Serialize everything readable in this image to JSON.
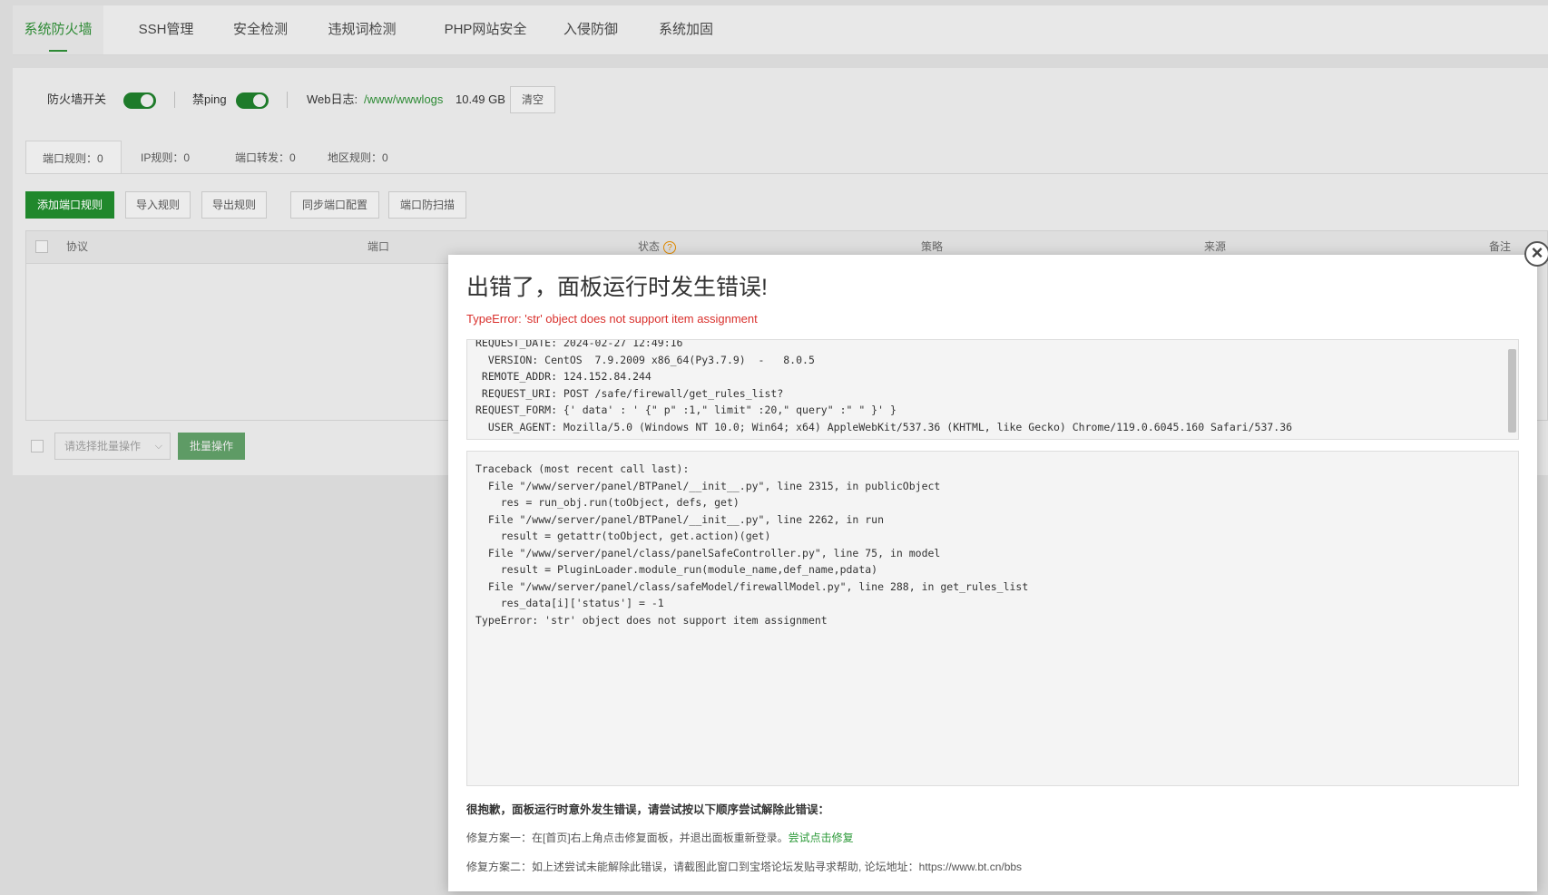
{
  "topnav": {
    "tabs": [
      {
        "label": "系统防火墙",
        "active": true
      },
      {
        "label": "SSH管理"
      },
      {
        "label": "安全检测"
      },
      {
        "label": "违规词检测"
      },
      {
        "label": "PHP网站安全"
      },
      {
        "label": "入侵防御"
      },
      {
        "label": "系统加固"
      }
    ]
  },
  "statusbar": {
    "firewall_label": "防火墙开关",
    "ping_label": "禁ping",
    "weblog_label": "Web日志:",
    "weblog_path": "/www/wwwlogs",
    "weblog_size": "10.49 GB",
    "clear_label": "清空"
  },
  "subtabs": [
    {
      "label": "端口规则：0",
      "active": true
    },
    {
      "label": "IP规则：0"
    },
    {
      "label": "端口转发：0"
    },
    {
      "label": "地区规则：0"
    }
  ],
  "actions": {
    "add": "添加端口规则",
    "import": "导入规则",
    "export": "导出规则",
    "sync": "同步端口配置",
    "scan": "端口防扫描"
  },
  "table": {
    "headers": [
      "协议",
      "端口",
      "状态",
      "策略",
      "来源",
      "备注"
    ]
  },
  "bulk": {
    "select_placeholder": "请选择批量操作",
    "button": "批量操作"
  },
  "modal": {
    "title": "出错了，面板运行时发生错误!",
    "error": "TypeError: 'str' object does not support item assignment",
    "info_lines": [
      "REQUEST_DATE: 2024-02-27 12:49:16",
      "  VERSION: CentOS  7.9.2009 x86_64(Py3.7.9)  -   8.0.5",
      " REMOTE_ADDR: 124.152.84.244",
      " REQUEST_URI: POST /safe/firewall/get_rules_list?",
      "REQUEST_FORM: {' data' : ' {\" p\" :1,\" limit\" :20,\" query\" :\" \" }' }",
      "  USER_AGENT: Mozilla/5.0 (Windows NT 10.0; Win64; x64) AppleWebKit/537.36 (KHTML, like Gecko) Chrome/119.0.6045.160 Safari/537.36"
    ],
    "traceback_lines": [
      "Traceback (most recent call last):",
      "  File \"/www/server/panel/BTPanel/__init__.py\", line 2315, in publicObject",
      "    res = run_obj.run(toObject, defs, get)",
      "  File \"/www/server/panel/BTPanel/__init__.py\", line 2262, in run",
      "    result = getattr(toObject, get.action)(get)",
      "  File \"/www/server/panel/class/panelSafeController.py\", line 75, in model",
      "    result = PluginLoader.module_run(module_name,def_name,pdata)",
      "  File \"/www/server/panel/class/safeModel/firewallModel.py\", line 288, in get_rules_list",
      "    res_data[i]['status'] = -1",
      "TypeError: 'str' object does not support item assignment"
    ],
    "help_heading": "很抱歉，面板运行时意外发生错误，请尝试按以下顺序尝试解除此错误：",
    "fix1_text": "修复方案一：在[首页]右上角点击修复面板，并退出面板重新登录。",
    "fix1_link": "尝试点击修复",
    "fix2_text": "修复方案二：如上述尝试未能解除此错误，请截图此窗口到宝塔论坛发贴寻求帮助, 论坛地址：https://www.bt.cn/bbs",
    "close_symbol": "×"
  },
  "colors": {
    "accent": "#20882c",
    "error": "#d9302c",
    "link": "#2d9a3a"
  }
}
